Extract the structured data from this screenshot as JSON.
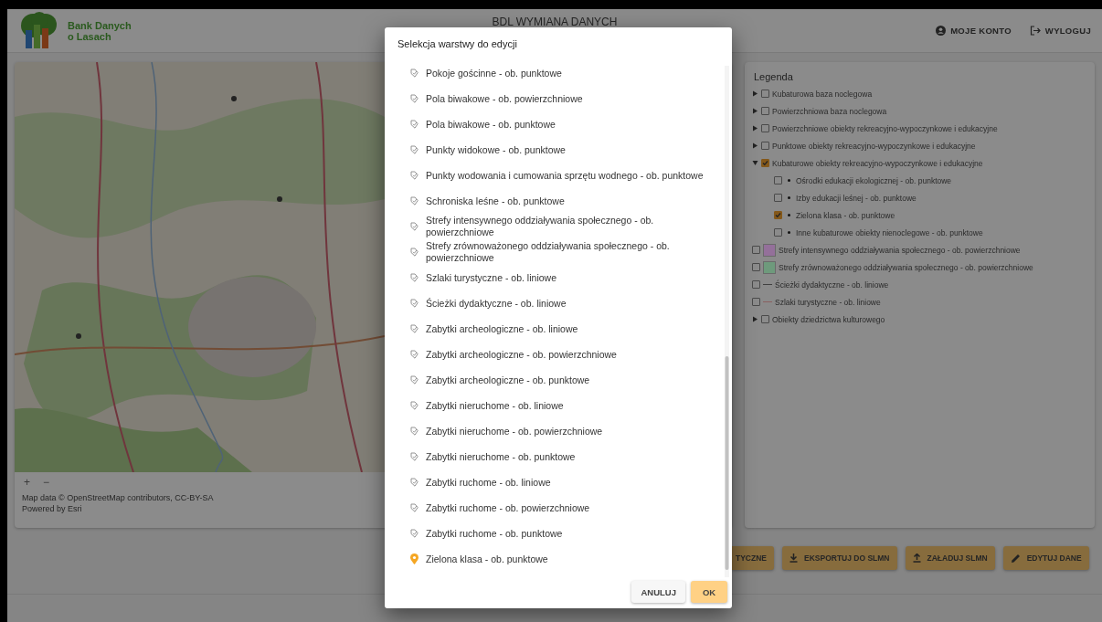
{
  "header": {
    "logo_lines": [
      "Bank Danych",
      "o Lasach"
    ],
    "title": "BDL WYMIANA DANYCH",
    "links": [
      {
        "kind": "account",
        "label": "MOJE KONTO"
      },
      {
        "kind": "logout",
        "label": "WYLOGUJ"
      }
    ]
  },
  "map": {
    "zoom_controls": [
      "+",
      "−"
    ],
    "attribution": [
      "Map data © OpenStreetMap contributors, CC-BY-SA",
      "Powered by Esri"
    ]
  },
  "legend": {
    "title": "Legenda",
    "items": [
      {
        "kind": "group",
        "label": "Kubaturowa baza noclegowa",
        "checked": false,
        "expanded": false
      },
      {
        "kind": "group",
        "label": "Powierzchniowa baza noclegowa",
        "checked": false,
        "expanded": false
      },
      {
        "kind": "group",
        "label": "Powierzchniowe obiekty rekreacyjno-wypoczynkowe i edukacyjne",
        "checked": false,
        "expanded": false
      },
      {
        "kind": "group",
        "label": "Punktowe obiekty rekreacyjno-wypoczynkowe i edukacyjne",
        "checked": false,
        "expanded": false
      },
      {
        "kind": "group",
        "label": "Kubaturowe obiekty rekreacyjno-wypoczynkowe i edukacyjne",
        "checked": true,
        "expanded": true,
        "children": [
          {
            "kind": "point",
            "label": "Ośrodki edukacji ekologicznej - ob. punktowe",
            "checked": false
          },
          {
            "kind": "point",
            "label": "Izby edukacji leśnej - ob. punktowe",
            "checked": false
          },
          {
            "kind": "point",
            "label": "Zielona klasa - ob. punktowe",
            "checked": true
          },
          {
            "kind": "point",
            "label": "Inne kubaturowe obiekty nienoclegowe - ob. punktowe",
            "checked": false
          }
        ]
      },
      {
        "kind": "area",
        "label": "Strefy intensywnego oddziaływania społecznego - ob. powierzchniowe",
        "checked": false,
        "color": "#94709a"
      },
      {
        "kind": "area",
        "label": "Strefy zrównoważonego oddziaływania społecznego - ob. powierzchniowe",
        "checked": false,
        "color": "#6e9a7c"
      },
      {
        "kind": "line",
        "label": "Ścieżki dydaktyczne - ob. liniowe",
        "checked": false,
        "color": "#404040"
      },
      {
        "kind": "line",
        "label": "Szlaki turystyczne - ob. liniowe",
        "checked": false,
        "color": "#8a6060"
      },
      {
        "kind": "group",
        "label": "Obiekty dziedzictwa kulturowego",
        "checked": false,
        "expanded": false
      }
    ]
  },
  "actions": [
    {
      "kind": "plain",
      "label": "TYCZNE"
    },
    {
      "kind": "download",
      "label": "EKSPORTUJ DO SLMN"
    },
    {
      "kind": "upload",
      "label": "ZAŁADUJ SLMN"
    },
    {
      "kind": "edit",
      "label": "EDYTUJ DANE"
    }
  ],
  "dialog": {
    "title": "Selekcja warstwy do edycji",
    "layers": [
      {
        "label": "Pokoje gościnne - ob. punktowe",
        "selected": false
      },
      {
        "label": "Pola biwakowe - ob. powierzchniowe",
        "selected": false
      },
      {
        "label": "Pola biwakowe - ob. punktowe",
        "selected": false
      },
      {
        "label": "Punkty widokowe - ob. punktowe",
        "selected": false
      },
      {
        "label": "Punkty wodowania i cumowania sprzętu wodnego - ob. punktowe",
        "selected": false
      },
      {
        "label": "Schroniska leśne - ob. punktowe",
        "selected": false
      },
      {
        "label": "Strefy intensywnego oddziaływania społecznego - ob. powierzchniowe",
        "selected": false
      },
      {
        "label": "Strefy zrównoważonego oddziaływania społecznego - ob. powierzchniowe",
        "selected": false
      },
      {
        "label": "Szlaki turystyczne - ob. liniowe",
        "selected": false
      },
      {
        "label": "Ścieżki dydaktyczne - ob. liniowe",
        "selected": false
      },
      {
        "label": "Zabytki archeologiczne - ob. liniowe",
        "selected": false
      },
      {
        "label": "Zabytki archeologiczne - ob. powierzchniowe",
        "selected": false
      },
      {
        "label": "Zabytki archeologiczne - ob. punktowe",
        "selected": false
      },
      {
        "label": "Zabytki nieruchome - ob. liniowe",
        "selected": false
      },
      {
        "label": "Zabytki nieruchome - ob. powierzchniowe",
        "selected": false
      },
      {
        "label": "Zabytki nieruchome - ob. punktowe",
        "selected": false
      },
      {
        "label": "Zabytki ruchome - ob. liniowe",
        "selected": false
      },
      {
        "label": "Zabytki ruchome - ob. powierzchniowe",
        "selected": false
      },
      {
        "label": "Zabytki ruchome - ob. punktowe",
        "selected": false
      },
      {
        "label": "Zielona klasa - ob. punktowe",
        "selected": true
      }
    ],
    "buttons": [
      {
        "kind": "cancel",
        "label": "ANULUJ"
      },
      {
        "kind": "confirm",
        "label": "OK"
      }
    ]
  }
}
